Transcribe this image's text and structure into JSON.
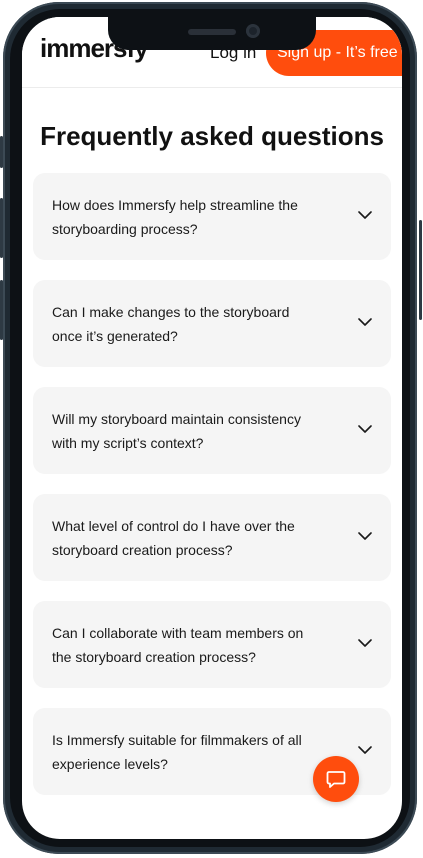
{
  "header": {
    "logo_text": "immersfy",
    "login_label": "Log in",
    "signup_label": "Sign up - It’s free"
  },
  "faq": {
    "title": "Frequently asked questions",
    "items": [
      {
        "question": "How does Immersfy help streamline the storyboarding process?"
      },
      {
        "question": "Can I make changes to the storyboard once it’s generated?"
      },
      {
        "question": "Will my storyboard maintain consistency with my script’s context?"
      },
      {
        "question": "What level of control do I have over the storyboard creation process?"
      },
      {
        "question": "Can I collaborate with team members on the storyboard creation process?"
      },
      {
        "question": "Is Immersfy suitable for filmmakers of all experience levels?"
      }
    ]
  },
  "icons": {
    "faq_toggle": "chevron-down-icon",
    "chat": "chat-bubble-icon"
  },
  "colors": {
    "accent": "#ff4d0d",
    "card_bg": "#f5f5f5",
    "text": "#111111"
  }
}
